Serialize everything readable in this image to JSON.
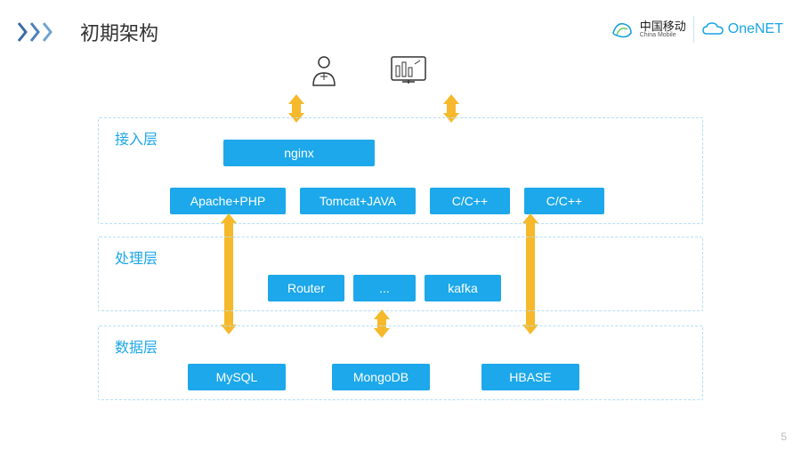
{
  "title": "初期架构",
  "logo": {
    "cn": "中国移动",
    "en": "China Mobile",
    "product": "OneNET"
  },
  "layers": {
    "access": {
      "label": "接入层",
      "nginx": "nginx",
      "apache": "Apache+PHP",
      "tomcat": "Tomcat+JAVA",
      "cc1": "C/C++",
      "cc2": "C/C++"
    },
    "process": {
      "label": "处理层",
      "router": "Router",
      "dots": "...",
      "kafka": "kafka"
    },
    "data": {
      "label": "数据层",
      "mysql": "MySQL",
      "mongo": "MongoDB",
      "hbase": "HBASE"
    }
  },
  "page_number": "5"
}
